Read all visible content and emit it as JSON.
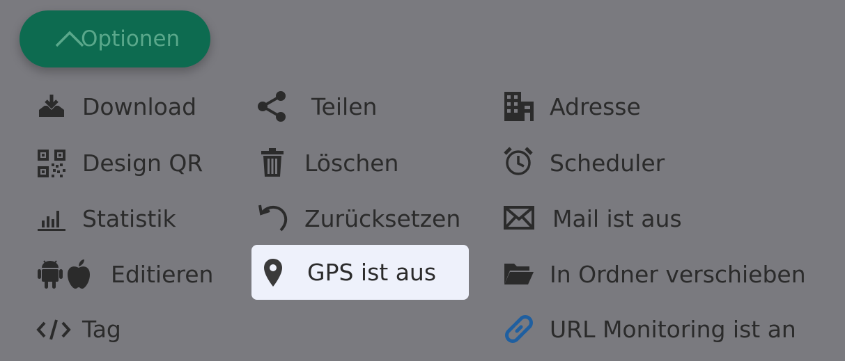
{
  "options_button": {
    "label": "Optionen",
    "icon": "chevron-up-icon"
  },
  "menu": {
    "download": "Download",
    "design_qr": "Design QR",
    "statistik": "Statistik",
    "editieren": "Editieren",
    "tag": "Tag",
    "teilen": "Teilen",
    "loeschen": "Löschen",
    "zuruecksetzen": "Zurücksetzen",
    "gps": "GPS ist aus",
    "adresse": "Adresse",
    "scheduler": "Scheduler",
    "mail": "Mail ist aus",
    "ordner": "In Ordner verschieben",
    "url_monitoring": "URL Monitoring ist an"
  },
  "colors": {
    "overlay_bg": "#7a7a7f",
    "button_bg": "#0d6b50",
    "button_text": "#5aa88b",
    "highlight_bg": "#eef1fb",
    "link_icon": "#1f5fa0"
  }
}
